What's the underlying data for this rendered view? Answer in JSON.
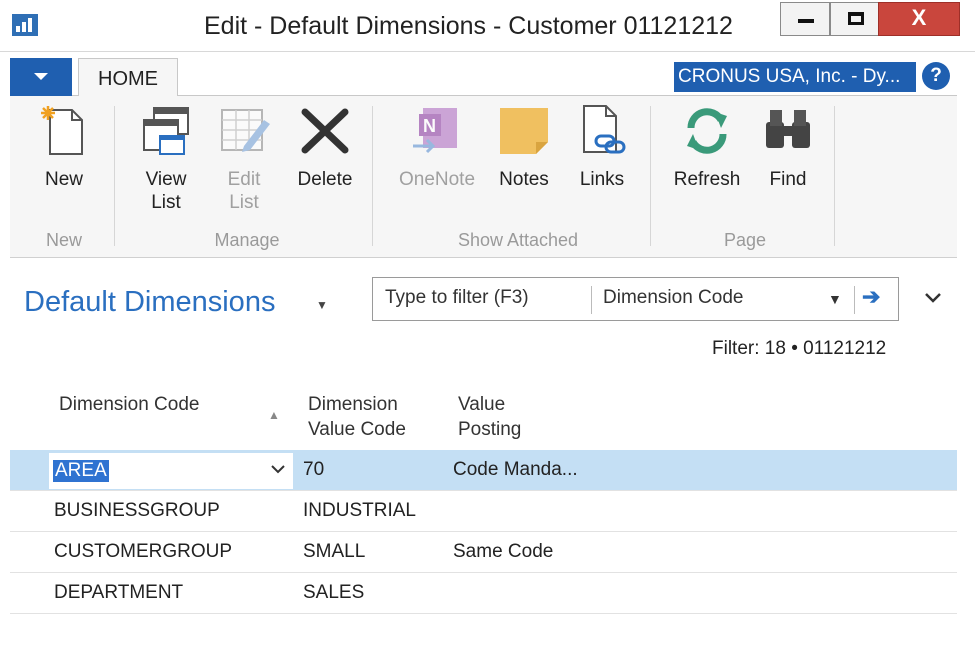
{
  "window": {
    "title": "Edit - Default Dimensions - Customer 01121212",
    "minimize": "",
    "maximize": "",
    "close": "X"
  },
  "ribbon": {
    "tab_home": "HOME",
    "company": "CRONUS USA, Inc. - Dy...",
    "help": "?",
    "new_group": {
      "label": "New",
      "new_line1": "New"
    },
    "manage_group": {
      "label": "Manage",
      "view_line1": "View",
      "view_line2": "List",
      "edit_line1": "Edit",
      "edit_line2": "List",
      "delete_line1": "Delete"
    },
    "attached_group": {
      "label": "Show Attached",
      "onenote": "OneNote",
      "notes": "Notes",
      "links": "Links"
    },
    "page_group": {
      "label": "Page",
      "refresh": "Refresh",
      "find": "Find"
    }
  },
  "page": {
    "title": "Default Dimensions",
    "filter_placeholder": "Type to filter (F3)",
    "filter_field": "Dimension Code",
    "filter_status": "Filter: 18 • 01121212"
  },
  "table": {
    "headers": {
      "dim_code": "Dimension Code",
      "value_code_l1": "Dimension",
      "value_code_l2": "Value Code",
      "posting_l1": "Value",
      "posting_l2": "Posting"
    },
    "rows": [
      {
        "dim_code": "AREA",
        "value_code": "70",
        "posting": "Code Manda..."
      },
      {
        "dim_code": "BUSINESSGROUP",
        "value_code": "INDUSTRIAL",
        "posting": ""
      },
      {
        "dim_code": "CUSTOMERGROUP",
        "value_code": "SMALL",
        "posting": "Same Code"
      },
      {
        "dim_code": "DEPARTMENT",
        "value_code": "SALES",
        "posting": ""
      }
    ]
  }
}
